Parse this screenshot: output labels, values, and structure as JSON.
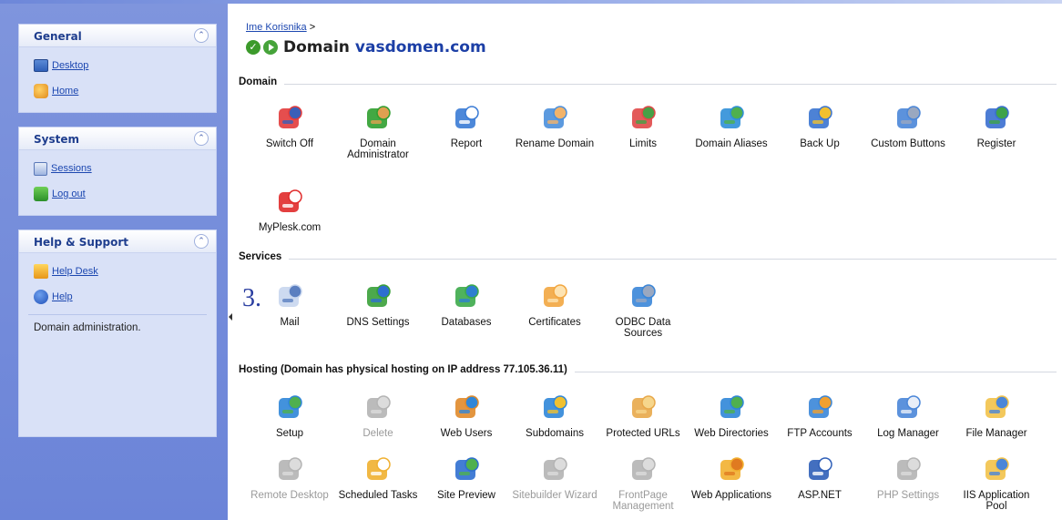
{
  "sidebar": {
    "general": {
      "title": "General",
      "links": [
        {
          "label": "Desktop",
          "icon": "desktop-icon"
        },
        {
          "label": "Home",
          "icon": "home-icon"
        }
      ]
    },
    "system": {
      "title": "System",
      "links": [
        {
          "label": "Sessions",
          "icon": "sessions-icon"
        },
        {
          "label": "Log out",
          "icon": "logout-icon"
        }
      ]
    },
    "help": {
      "title": "Help & Support",
      "links": [
        {
          "label": "Help Desk",
          "icon": "helpdesk-icon"
        },
        {
          "label": "Help",
          "icon": "help-icon"
        }
      ],
      "description": "Domain administration."
    }
  },
  "breadcrumb": {
    "link": "Ime Korisnika",
    "sep": ">"
  },
  "title": {
    "prefix": "Domain",
    "domain": "vasdomen.com"
  },
  "annotation": "3.",
  "sections": {
    "domain": {
      "label": "Domain",
      "items": [
        {
          "label": "Switch Off",
          "icon": "switch-off-icon",
          "disabled": false
        },
        {
          "label": "Domain Administrator",
          "icon": "domain-admin-icon",
          "disabled": false
        },
        {
          "label": "Report",
          "icon": "report-icon",
          "disabled": false
        },
        {
          "label": "Rename Domain",
          "icon": "rename-domain-icon",
          "disabled": false
        },
        {
          "label": "Limits",
          "icon": "limits-icon",
          "disabled": false
        },
        {
          "label": "Domain Aliases",
          "icon": "domain-aliases-icon",
          "disabled": false
        },
        {
          "label": "Back Up",
          "icon": "backup-icon",
          "disabled": false
        },
        {
          "label": "Custom Buttons",
          "icon": "custom-buttons-icon",
          "disabled": false
        },
        {
          "label": "Register",
          "icon": "register-icon",
          "disabled": false
        },
        {
          "label": "MyPlesk.com",
          "icon": "myplesk-icon",
          "disabled": false
        }
      ]
    },
    "services": {
      "label": "Services",
      "items": [
        {
          "label": "Mail",
          "icon": "mail-icon",
          "disabled": false
        },
        {
          "label": "DNS Settings",
          "icon": "dns-icon",
          "disabled": false
        },
        {
          "label": "Databases",
          "icon": "databases-icon",
          "disabled": false
        },
        {
          "label": "Certificates",
          "icon": "certificates-icon",
          "disabled": false
        },
        {
          "label": "ODBC Data Sources",
          "icon": "odbc-icon",
          "disabled": false
        }
      ]
    },
    "hosting": {
      "label": "Hosting (Domain has physical hosting on IP address 77.105.36.11)",
      "items": [
        {
          "label": "Setup",
          "icon": "setup-icon",
          "disabled": false
        },
        {
          "label": "Delete",
          "icon": "delete-icon",
          "disabled": true
        },
        {
          "label": "Web Users",
          "icon": "web-users-icon",
          "disabled": false
        },
        {
          "label": "Subdomains",
          "icon": "subdomains-icon",
          "disabled": false
        },
        {
          "label": "Protected URLs",
          "icon": "protected-urls-icon",
          "disabled": false
        },
        {
          "label": "Web Directories",
          "icon": "web-directories-icon",
          "disabled": false
        },
        {
          "label": "FTP Accounts",
          "icon": "ftp-icon",
          "disabled": false
        },
        {
          "label": "Log Manager",
          "icon": "log-manager-icon",
          "disabled": false
        },
        {
          "label": "File Manager",
          "icon": "file-manager-icon",
          "disabled": false
        },
        {
          "label": "Remote Desktop",
          "icon": "remote-desktop-icon",
          "disabled": true
        },
        {
          "label": "Scheduled Tasks",
          "icon": "scheduled-tasks-icon",
          "disabled": false
        },
        {
          "label": "Site Preview",
          "icon": "site-preview-icon",
          "disabled": false
        },
        {
          "label": "Sitebuilder Wizard",
          "icon": "sitebuilder-icon",
          "disabled": true
        },
        {
          "label": "FrontPage Management",
          "icon": "frontpage-icon",
          "disabled": true
        },
        {
          "label": "Web Applications",
          "icon": "web-applications-icon",
          "disabled": false
        },
        {
          "label": "ASP.NET",
          "icon": "aspnet-icon",
          "disabled": false
        },
        {
          "label": "PHP Settings",
          "icon": "php-icon",
          "disabled": true
        },
        {
          "label": "IIS Application Pool",
          "icon": "iis-pool-icon",
          "disabled": false
        }
      ]
    }
  }
}
